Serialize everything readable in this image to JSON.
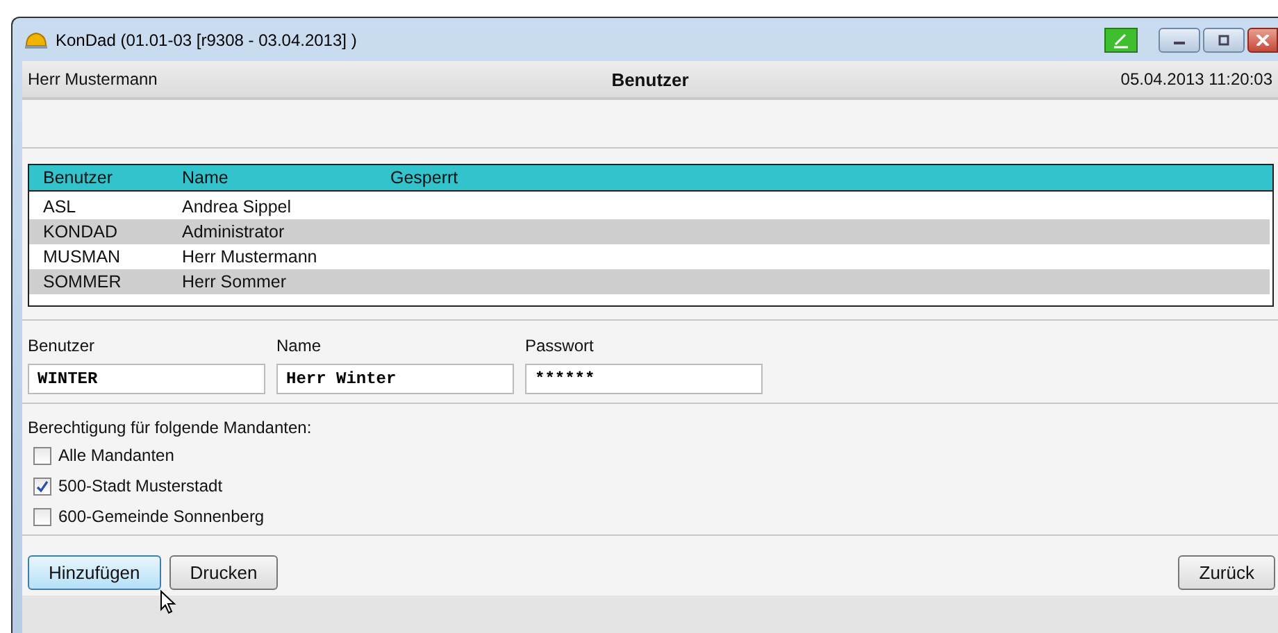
{
  "window": {
    "title": "KonDad (01.01-03 [r9308 - 03.04.2013] )"
  },
  "header": {
    "user": "Herr Mustermann",
    "title": "Benutzer",
    "datetime": "05.04.2013 11:20:03"
  },
  "table": {
    "columns": [
      "Benutzer",
      "Name",
      "Gesperrt"
    ],
    "rows": [
      {
        "cells": [
          "ASL",
          "Andrea Sippel"
        ]
      },
      {
        "cells": [
          "KONDAD",
          "Administrator"
        ]
      },
      {
        "cells": [
          "MUSMAN",
          "Herr Mustermann"
        ]
      },
      {
        "cells": [
          "SOMMER",
          "Herr Sommer"
        ]
      }
    ]
  },
  "form": {
    "fields": [
      {
        "label": "Benutzer",
        "value": "WINTER"
      },
      {
        "label": "Name",
        "value": "Herr Winter"
      },
      {
        "label": "Passwort",
        "value": "******"
      }
    ]
  },
  "permissions": {
    "heading": "Berechtigung für folgende Mandanten:",
    "items": [
      {
        "label": "Alle Mandanten",
        "checked": false
      },
      {
        "label": "500-Stadt Musterstadt",
        "checked": true
      },
      {
        "label": "600-Gemeinde Sonnenberg",
        "checked": false
      }
    ]
  },
  "buttons": [
    {
      "label": "Hinzufügen",
      "highlighted": true
    },
    {
      "label": "Drucken",
      "highlighted": false
    }
  ],
  "back_button": {
    "label": "Zurück"
  }
}
